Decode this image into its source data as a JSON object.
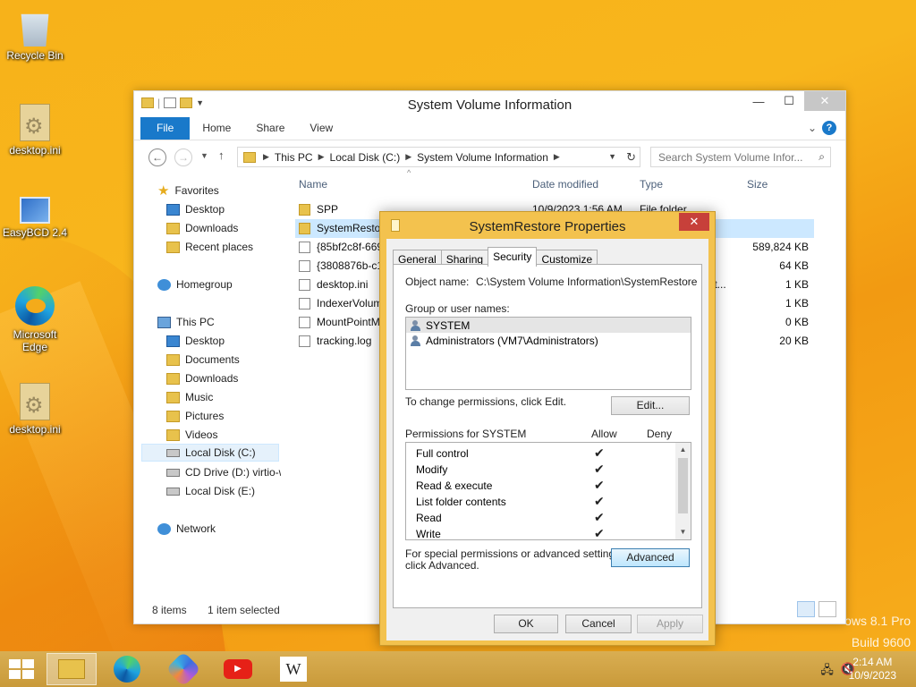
{
  "desktop": {
    "icons": [
      {
        "label": "Recycle Bin"
      },
      {
        "label": "desktop.ini"
      },
      {
        "label": "EasyBCD 2.4"
      },
      {
        "label": "Microsoft Edge"
      },
      {
        "label": "desktop.ini"
      }
    ],
    "watermark": {
      "line1": "ows 8.1 Pro",
      "line2": "Build 9600"
    }
  },
  "explorer": {
    "title": "System Volume Information",
    "ribbon_tabs": [
      "File",
      "Home",
      "Share",
      "View"
    ],
    "help": "?",
    "breadcrumb": [
      "This PC",
      "Local Disk (C:)",
      "System Volume Information"
    ],
    "search_placeholder": "Search System Volume Infor...",
    "nav": {
      "favorites": "Favorites",
      "fav_items": [
        "Desktop",
        "Downloads",
        "Recent places"
      ],
      "homegroup": "Homegroup",
      "thispc": "This PC",
      "pc_items": [
        "Desktop",
        "Documents",
        "Downloads",
        "Music",
        "Pictures",
        "Videos",
        "Local Disk (C:)",
        "CD Drive (D:) virtio-w",
        "Local Disk (E:)"
      ],
      "network": "Network"
    },
    "columns": {
      "name": "Name",
      "date": "Date modified",
      "type": "Type",
      "size": "Size"
    },
    "files": [
      {
        "name": "SPP",
        "date": "10/9/2023 1:56 AM",
        "type": "File folder",
        "size": ""
      },
      {
        "name": "SystemRestore",
        "date": "",
        "type": "",
        "size": ""
      },
      {
        "name": "{85bf2c8f-669",
        "date": "",
        "type": "",
        "size": "589,824 KB"
      },
      {
        "name": "{3808876b-c1",
        "date": "",
        "type": "",
        "size": "64 KB"
      },
      {
        "name": "desktop.ini",
        "date": "",
        "type": "tt...",
        "size": "1 KB"
      },
      {
        "name": "IndexerVolum",
        "date": "",
        "type": "",
        "size": "1 KB"
      },
      {
        "name": "MountPointM",
        "date": "",
        "type": "",
        "size": "0 KB"
      },
      {
        "name": "tracking.log",
        "date": "",
        "type": "",
        "size": "20 KB"
      }
    ],
    "status": {
      "count": "8 items",
      "selected": "1 item selected"
    }
  },
  "dialog": {
    "title": "SystemRestore Properties",
    "tabs": [
      "General",
      "Sharing",
      "Security",
      "Customize"
    ],
    "object_label": "Object name:",
    "object_value": "C:\\System Volume Information\\SystemRestore",
    "group_label": "Group or user names:",
    "users": [
      "SYSTEM",
      "Administrators (VM7\\Administrators)"
    ],
    "change_text": "To change permissions, click Edit.",
    "edit_btn": "Edit...",
    "perm_label": "Permissions for SYSTEM",
    "allow": "Allow",
    "deny": "Deny",
    "permissions": [
      {
        "name": "Full control",
        "allow": "✔"
      },
      {
        "name": "Modify",
        "allow": "✔"
      },
      {
        "name": "Read & execute",
        "allow": "✔"
      },
      {
        "name": "List folder contents",
        "allow": "✔"
      },
      {
        "name": "Read",
        "allow": "✔"
      },
      {
        "name": "Write",
        "allow": "✔"
      }
    ],
    "special_line1": "For special permissions or advanced settings,",
    "special_line2": "click Advanced.",
    "advanced_btn": "Advanced",
    "ok": "OK",
    "cancel": "Cancel",
    "apply": "Apply"
  },
  "taskbar": {
    "youtube": "▶",
    "wiki": "W",
    "time": "2:14 AM",
    "date": "10/9/2023"
  }
}
